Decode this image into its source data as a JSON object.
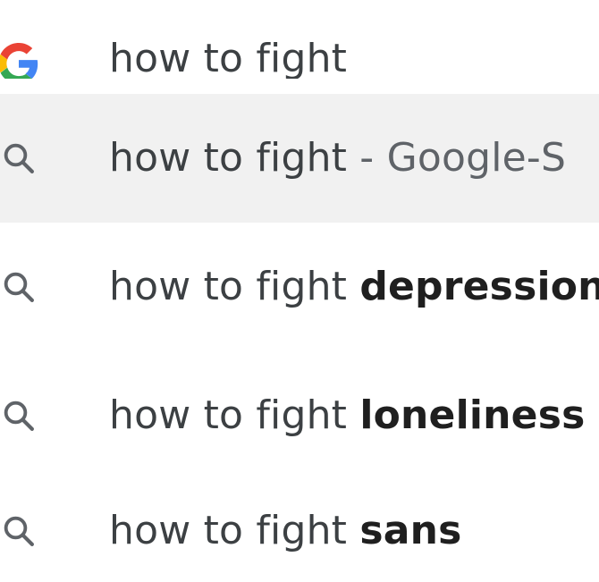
{
  "search": {
    "query": "how to fight",
    "engine_icon": "google-g-icon"
  },
  "suggestions": [
    {
      "icon": "search-icon",
      "prefix": "how to fight",
      "completion": "",
      "descriptor": " - Google-S",
      "highlighted": true
    },
    {
      "icon": "search-icon",
      "prefix": "how to fight",
      "completion": "depression",
      "descriptor": "",
      "highlighted": false
    },
    {
      "icon": "search-icon",
      "prefix": "how to fight",
      "completion": "loneliness",
      "descriptor": "",
      "highlighted": false
    },
    {
      "icon": "search-icon",
      "prefix": "how to fight",
      "completion": "sans",
      "descriptor": "",
      "highlighted": false
    }
  ],
  "colors": {
    "highlight_bg": "#f1f1f1",
    "text": "#3c4043",
    "bold_text": "#1f1f1f",
    "descriptor_text": "#5f6368",
    "icon_gray": "#5f6368",
    "google_blue": "#4285F4",
    "google_red": "#EA4335",
    "google_yellow": "#FBBC05",
    "google_green": "#34A853"
  }
}
